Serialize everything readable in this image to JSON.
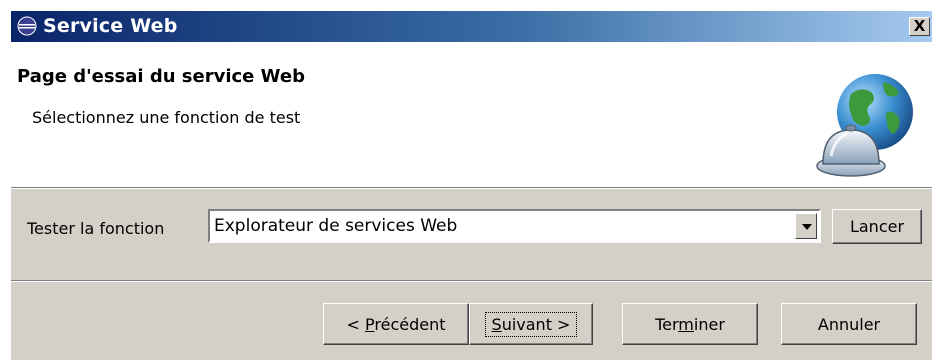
{
  "window": {
    "title": "Service Web",
    "close_label": "X"
  },
  "banner": {
    "title": "Page d'essai du service Web",
    "description": "Sélectionnez une fonction de test",
    "icon": "globe-bell-icon"
  },
  "form": {
    "test_label": "Tester la fonction",
    "selected_function": "Explorateur de services Web",
    "launch_label": "Lancer"
  },
  "buttons": {
    "back": {
      "prefix": "< ",
      "mnemonic": "P",
      "rest": "récédent"
    },
    "next": {
      "mnemonic": "S",
      "rest": "uivant >"
    },
    "finish": {
      "prefix": "Ter",
      "mnemonic": "m",
      "rest": "iner"
    },
    "cancel_label": "Annuler"
  }
}
